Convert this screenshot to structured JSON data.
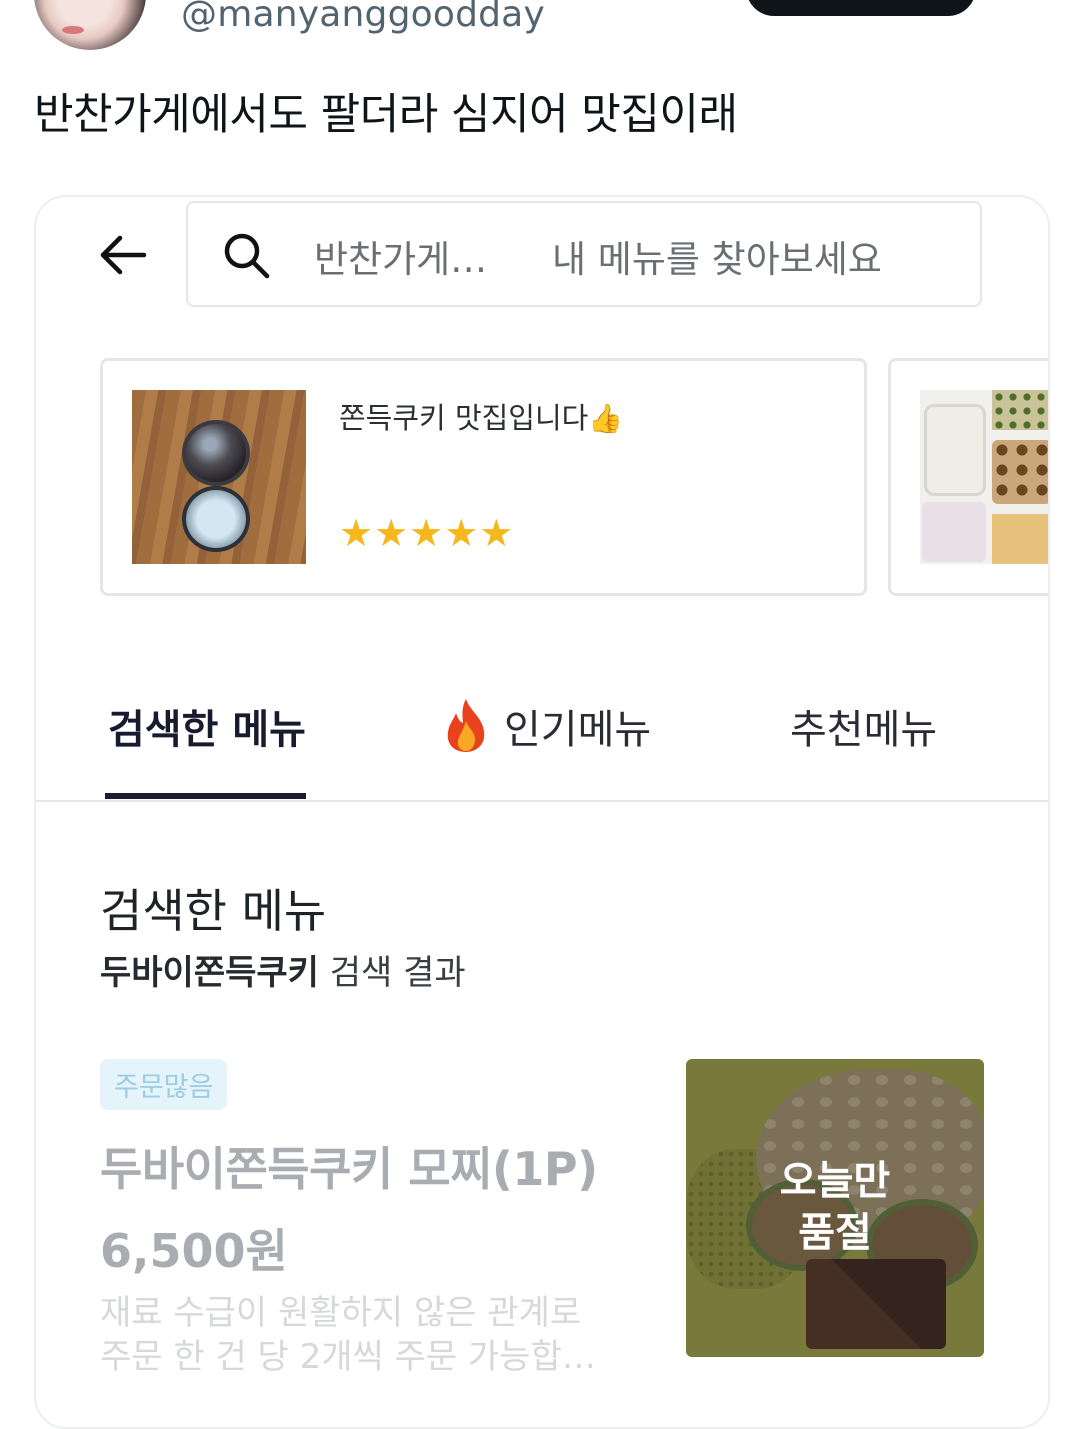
{
  "tweet": {
    "handle": "@manyanggoodday",
    "text": "반찬가게에서도 팔더라 심지어 맛집이래"
  },
  "app": {
    "search": {
      "store_name": "반찬가게…",
      "placeholder": "내 메뉴를 찾아보세요"
    },
    "reviews": [
      {
        "text": "쫀득쿠키 맛집입니다",
        "emoji": "👍",
        "stars": "★★★★★",
        "rating": 5
      }
    ],
    "tabs": [
      {
        "label": "검색한 메뉴",
        "active": true
      },
      {
        "label": "인기메뉴",
        "icon": "fire-icon"
      },
      {
        "label": "추천메뉴"
      }
    ],
    "section": {
      "title": "검색한 메뉴",
      "query": "두바이쫀득쿠키",
      "result_suffix": "검색 결과"
    },
    "menu_item": {
      "badge": "주문많음",
      "name": "두바이쫀득쿠키 모찌(1P)",
      "price": "6,500원",
      "description_line1": "재료 수급이 원활하지 않은 관계로",
      "description_line2": "주문 한 건 당 2개씩 주문 가능합…",
      "soldout_line1": "오늘만",
      "soldout_line2": "품절"
    },
    "colors": {
      "tab_indicator": "#1c1b2e",
      "star": "#f5b71b",
      "badge_bg": "#e5f3fa",
      "badge_text": "#9ccde4"
    }
  }
}
